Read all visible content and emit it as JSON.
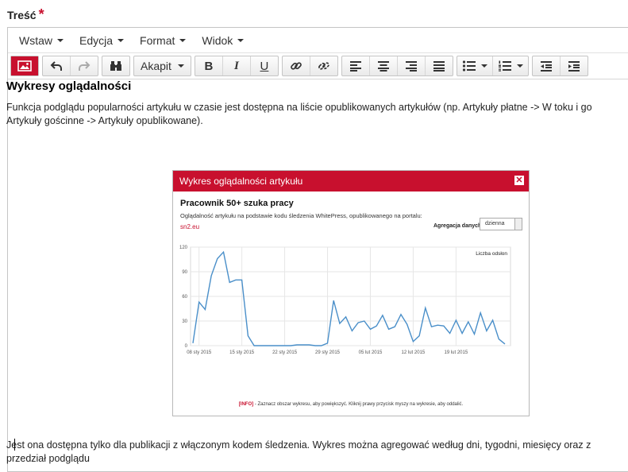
{
  "field": {
    "label": "Treść",
    "required_mark": "*"
  },
  "menubar": {
    "items": [
      "Wstaw",
      "Edycja",
      "Format",
      "Widok"
    ]
  },
  "toolbar": {
    "block_format": "Akapit"
  },
  "content": {
    "heading": "Wykresy oglądalności",
    "paragraph1_line1": "Funkcja podglądu popularności artykułu w czasie jest dostępna na liście opublikowanych artykułów (np. Artykuły płatne -> W toku i go",
    "paragraph1_line2": "Artykuły gościnne -> Artykuły opublikowane).",
    "paragraph2_line1": "Jest ona dostępna tylko dla publikacji z włączonym kodem śledzenia. Wykres można agregować według dni, tygodni, miesięcy oraz z",
    "paragraph2_line2": "przedział podglądu"
  },
  "screenshot": {
    "window_title": "Wykres oglądalności artykułu",
    "close_symbol": "✕",
    "article_title": "Pracownik 50+ szuka pracy",
    "subtitle": "Oglądalność artykułu na podstawie kodu śledzenia WhitePress, opublikowanego na portalu:",
    "portal": "sn2.eu",
    "aggregation_label": "Agregacja danych:",
    "aggregation_value": "dzienna",
    "info_tag": "[INFO]",
    "info_text": " - Zaznacz obszar wykresu, aby powiększyć. Kliknij prawy przycisk myszy na wykresie, aby oddalić."
  },
  "chart_data": {
    "type": "line",
    "legend": "Liczba odsłon",
    "legend_position": "top-right",
    "y_ticks": [
      "0",
      "30",
      "60",
      "90",
      "120"
    ],
    "ylim": [
      0,
      120
    ],
    "x_ticks": [
      "08 sty 2015",
      "15 sty 2015",
      "22 sty 2015",
      "29 sty 2015",
      "05 lut 2015",
      "12 lut 2015",
      "19 lut 2015"
    ],
    "grid": true,
    "color": "#4a8fc9",
    "values": [
      3,
      53,
      44,
      85,
      106,
      114,
      77,
      80,
      80,
      12,
      0,
      0,
      0,
      0,
      0,
      0,
      0,
      1,
      1,
      1,
      0,
      0,
      3,
      55,
      27,
      35,
      18,
      28,
      30,
      20,
      24,
      37,
      20,
      23,
      38,
      26,
      5,
      12,
      46,
      23,
      25,
      24,
      15,
      31,
      15,
      29,
      14,
      40,
      18,
      31,
      8,
      2
    ]
  }
}
